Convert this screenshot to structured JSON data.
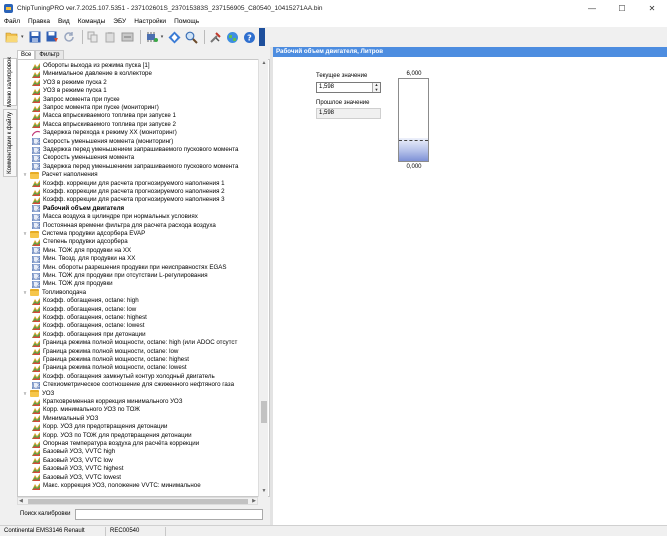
{
  "window": {
    "title": "ChipTuningPRO ver.7.2025.107.5351 - 237102601S_237015383S_237156905_C80540_10415271AA.bin"
  },
  "menu": [
    "Файл",
    "Правка",
    "Вид",
    "Команды",
    "ЭБУ",
    "Настройки",
    "Помощь"
  ],
  "side_tabs": [
    "Меню калибровок",
    "Комментарии к файлу"
  ],
  "filter_tabs": [
    "Все",
    "Фильтр"
  ],
  "tree": [
    {
      "label": "Обороты выхода из режима пуска [1]",
      "icon": "map",
      "level": 2
    },
    {
      "label": "Минимальное давление в коллекторе",
      "icon": "map",
      "level": 2
    },
    {
      "label": "УОЗ в режиме пуска 2",
      "icon": "map",
      "level": 2
    },
    {
      "label": "УОЗ в режиме пуска 1",
      "icon": "map",
      "level": 2
    },
    {
      "label": "Запрос момента при пуске",
      "icon": "map",
      "level": 2
    },
    {
      "label": "Запрос момента при пуске (мониторинг)",
      "icon": "map",
      "level": 2
    },
    {
      "label": "Масса впрыскиваемого топлива при запуске 1",
      "icon": "map",
      "level": 2
    },
    {
      "label": "Масса впрыскиваемого топлива при запуске 2",
      "icon": "map",
      "level": 2
    },
    {
      "label": "Задержка перехода к режиму ХХ (мониторинг)",
      "icon": "curve",
      "level": 2
    },
    {
      "label": "Скорость уменьшения момента (мониторинг)",
      "icon": "value",
      "level": 2
    },
    {
      "label": "Задержка перед уменьшением запрашиваемого пускового момента",
      "icon": "value",
      "level": 2
    },
    {
      "label": "Скорость уменьшения момента",
      "icon": "value",
      "level": 2
    },
    {
      "label": "Задержка перед уменьшением запрашиваемого пускового момента",
      "icon": "value",
      "level": 2
    },
    {
      "label": "Расчет наполнения",
      "icon": "folder",
      "level": 1
    },
    {
      "label": "Коэфф. коррекции для расчета прогнозируемого наполнения 1",
      "icon": "map",
      "level": 2
    },
    {
      "label": "Коэфф. коррекции для расчета прогнозируемого наполнения 2",
      "icon": "map",
      "level": 2
    },
    {
      "label": "Коэфф. коррекции для расчета прогнозируемого наполнения 3",
      "icon": "map",
      "level": 2
    },
    {
      "label": "Рабочий объем двигателя",
      "icon": "value",
      "level": 2,
      "selected": true
    },
    {
      "label": "Масса воздуха в цилиндре при нормальных условиях",
      "icon": "value",
      "level": 2
    },
    {
      "label": "Постоянная времени фильтра для расчета расхода воздуха",
      "icon": "value",
      "level": 2
    },
    {
      "label": "Система продувки адсорбера EVAP",
      "icon": "folder",
      "level": 1
    },
    {
      "label": "Степень продувки адсорбера",
      "icon": "map",
      "level": 2
    },
    {
      "label": "Мин. ТОЖ для продувки на ХХ",
      "icon": "value",
      "level": 2
    },
    {
      "label": "Мин. Твозд. для продувки на ХХ",
      "icon": "value",
      "level": 2
    },
    {
      "label": "Мин. обороты разрешения продувки при неисправностях EGAS",
      "icon": "value",
      "level": 2
    },
    {
      "label": "Мин. ТОЖ для продувки при отсутствии L-регулирования",
      "icon": "value",
      "level": 2
    },
    {
      "label": "Мин. ТОЖ для продувки",
      "icon": "value",
      "level": 2
    },
    {
      "label": "Топливоподача",
      "icon": "folder",
      "level": 1
    },
    {
      "label": "Коэфф. обогащения, octane: high",
      "icon": "map",
      "level": 2
    },
    {
      "label": "Коэфф. обогащения, octane: low",
      "icon": "map",
      "level": 2
    },
    {
      "label": "Коэфф. обогащения, octane: highest",
      "icon": "map",
      "level": 2
    },
    {
      "label": "Коэфф. обогащения, octane: lowest",
      "icon": "map",
      "level": 2
    },
    {
      "label": "Коэфф. обогащения при детонации",
      "icon": "map",
      "level": 2
    },
    {
      "label": "Граница режима полной мощности, octane: high (или ADOC отсутст",
      "icon": "map",
      "level": 2
    },
    {
      "label": "Граница режима полной мощности, octane: low",
      "icon": "map",
      "level": 2
    },
    {
      "label": "Граница режима полной мощности, octane: highest",
      "icon": "map",
      "level": 2
    },
    {
      "label": "Граница режима полной мощности, octane: lowest",
      "icon": "map",
      "level": 2
    },
    {
      "label": "Коэфф. обогащения замкнутый контур холодный двигатель",
      "icon": "map",
      "level": 2
    },
    {
      "label": "Стехиометрическое соотношение для сжиженного нефтяного газа",
      "icon": "value",
      "level": 2
    },
    {
      "label": "УОЗ",
      "icon": "folder",
      "level": 1
    },
    {
      "label": "Кратковременная коррекция минимального УОЗ",
      "icon": "map",
      "level": 2
    },
    {
      "label": "Корр. минимального УОЗ по ТОЖ",
      "icon": "map",
      "level": 2
    },
    {
      "label": "Минимальный УОЗ",
      "icon": "map",
      "level": 2
    },
    {
      "label": "Корр. УОЗ для предотвращения детонации",
      "icon": "map",
      "level": 2
    },
    {
      "label": "Корр. УОЗ по ТОЖ для предотвращения детонации",
      "icon": "map",
      "level": 2
    },
    {
      "label": "Опорная температура воздуха для расчёта коррекции",
      "icon": "map",
      "level": 2
    },
    {
      "label": "Базовый УОЗ, VVTC high",
      "icon": "map",
      "level": 2
    },
    {
      "label": "Базовый УОЗ, VVTC low",
      "icon": "map",
      "level": 2
    },
    {
      "label": "Базовый УОЗ, VVTC highest",
      "icon": "map",
      "level": 2
    },
    {
      "label": "Базовый УОЗ, VVTC lowest",
      "icon": "map",
      "level": 2
    },
    {
      "label": "Макс. коррекция УОЗ, положение VVTC: минимальное",
      "icon": "map",
      "level": 2
    }
  ],
  "search": {
    "label": "Поиск калибровки",
    "value": ""
  },
  "editor": {
    "header": "Рабочий объем двигателя, Литров",
    "current_label": "Текущее значение",
    "current_value": "1,598",
    "previous_label": "Прошлое значение",
    "previous_value": "1,598",
    "gauge_max": "6,000",
    "gauge_min": "0,000",
    "gauge_fill_fraction": 0.27
  },
  "status": {
    "ecu": "Continental EMS3146 Renault",
    "id": "REC00540"
  },
  "colors": {
    "header": "#4d8de0",
    "selected_text": "#000000"
  }
}
